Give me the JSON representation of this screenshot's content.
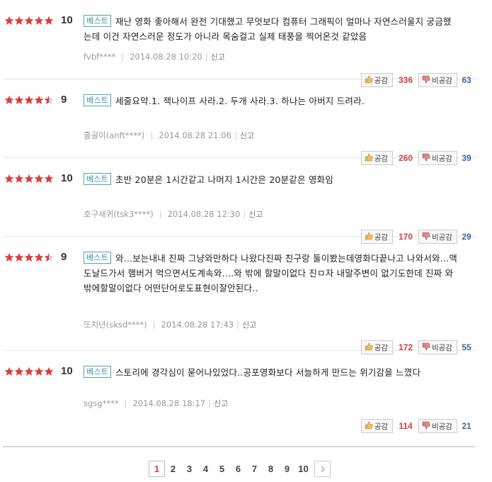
{
  "badge_label": "베스트",
  "report_label": "신고",
  "like_label": "공감",
  "dislike_label": "비공감",
  "star_color": "#e03c3c",
  "reviews": [
    {
      "stars": 5,
      "score": "10",
      "text": "재난 영화 좋아해서 완전 기대했고 무엇보다 컴퓨터 그래픽이 얼마나 자연스러울지 궁금했는데 이건 자연스러운 정도가 아니라 목숨걸고 실제 태풍을 찍어온것 같았음",
      "user": "fvbf****",
      "date": "2014.08.28 10:20",
      "likes": "336",
      "dislikes": "63"
    },
    {
      "stars": 4.5,
      "score": "9",
      "text": "세줄요약.1. 잭나이프 사라.2. 두개 사라.3. 하나는 아버지 드려라.",
      "user": "홀골이(anft****)",
      "date": "2014.08.28 21:06",
      "likes": "260",
      "dislikes": "39"
    },
    {
      "stars": 5,
      "score": "10",
      "text": "초반 20분은 1시간같고 나머지 1시간은 20분같은 영화임",
      "user": "호구새퀴(tsk3****)",
      "date": "2014.08.28 12:30",
      "likes": "170",
      "dislikes": "29"
    },
    {
      "stars": 4.5,
      "score": "9",
      "text": "와...보는내내 진짜 그냥와만하다 나왔다진짜 친구랑 둘이봤는데영화다끝나고 나와서와...맥도날드가서 햄버거 먹으면서도계속와....와 밖에 할말이없다 진ㅁ자 내말주변이 없기도한데 진짜 와밖에할말이없다 어떤단어로도표현이잘안된다..",
      "user": "또치년(sksd****)",
      "date": "2014.08.28 17:43",
      "likes": "172",
      "dislikes": "55"
    },
    {
      "stars": 5,
      "score": "10",
      "text": "스토리에 경각심이 묻어나있었다..공포영화보다 서늘하게 만드는 위기감을 느꼈다",
      "user": "sgsg****",
      "date": "2014.08.28 18:17",
      "likes": "114",
      "dislikes": "21"
    }
  ],
  "pagination": {
    "current": "1",
    "pages": [
      "1",
      "2",
      "3",
      "4",
      "5",
      "6",
      "7",
      "8",
      "9",
      "10"
    ],
    "next_icon": "chevron-right-icon"
  }
}
